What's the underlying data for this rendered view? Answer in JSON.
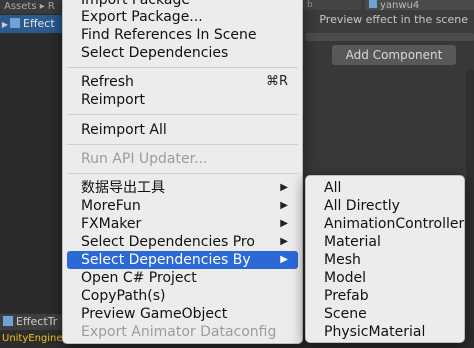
{
  "background": {
    "breadcrumb": "Assets ▸ R",
    "selected_item": "Effect",
    "tab_right_a": "b",
    "tab_right_b": "yanwu4",
    "preview_text": "Preview effect in the scene",
    "add_component_label": "Add Component",
    "bottom_tab": "EffectTr",
    "console_text": "UnityEngine."
  },
  "menu": {
    "items": [
      {
        "label": "Import Package",
        "cut_off": true
      },
      {
        "label": "Export Package..."
      },
      {
        "label": "Find References In Scene"
      },
      {
        "label": "Select Dependencies"
      },
      {
        "label": "Refresh",
        "shortcut": "⌘R"
      },
      {
        "label": "Reimport"
      },
      {
        "label": "Reimport All"
      },
      {
        "label": "Run API Updater...",
        "disabled": true
      },
      {
        "label": "数据导出工具",
        "submenu": true
      },
      {
        "label": "MoreFun",
        "submenu": true
      },
      {
        "label": "FXMaker",
        "submenu": true
      },
      {
        "label": "Select Dependencies Pro",
        "submenu": true
      },
      {
        "label": "Select Dependencies By",
        "submenu": true,
        "highlighted": true
      },
      {
        "label": "Open C# Project"
      },
      {
        "label": "CopyPath(s)"
      },
      {
        "label": "Preview GameObject"
      },
      {
        "label": "Export Animator Dataconfig",
        "disabled": true
      }
    ],
    "submenu_arrow_icon": "triangle-right-icon"
  },
  "submenu": {
    "items": [
      {
        "label": "All"
      },
      {
        "label": "All Directly"
      },
      {
        "label": "AnimationController"
      },
      {
        "label": "Material"
      },
      {
        "label": "Mesh"
      },
      {
        "label": "Model"
      },
      {
        "label": "Prefab"
      },
      {
        "label": "Scene"
      },
      {
        "label": "PhysicMaterial"
      }
    ]
  },
  "colors": {
    "highlight": "#2b69d6",
    "menu_bg": "#ececec",
    "disabled_text": "#9c9c9c",
    "console_warning": "#f0c020"
  }
}
